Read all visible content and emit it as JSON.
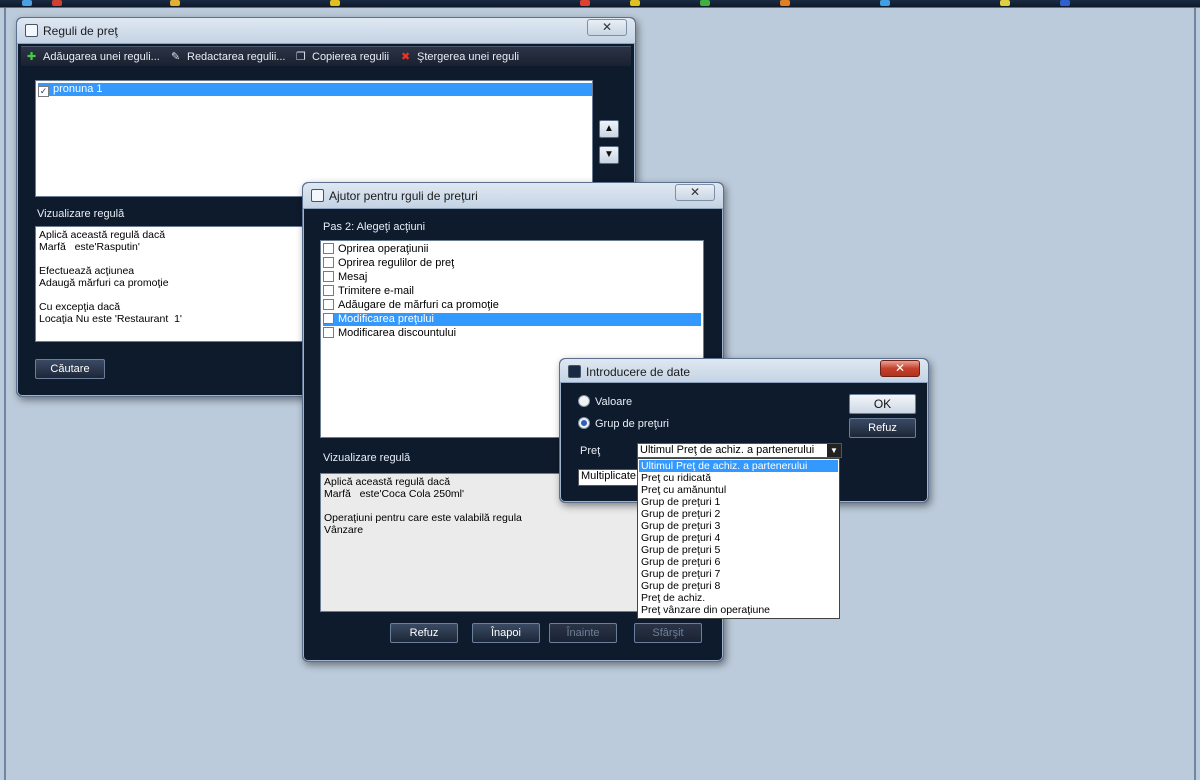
{
  "colors": {
    "desktop": "#bccbdb",
    "window_bg": "#0e1b2c",
    "selection": "#3399ff"
  },
  "rules_window": {
    "title": "Reguli de preţ",
    "close": "✕",
    "toolbar": [
      {
        "icon": "plus-icon",
        "glyph": "✚",
        "label": "Adăugarea unei reguli..."
      },
      {
        "icon": "edit-icon",
        "glyph": "✎",
        "label": "Redactarea regulii..."
      },
      {
        "icon": "copy-icon",
        "glyph": "❐",
        "label": "Copierea regulii"
      },
      {
        "icon": "delete-icon",
        "glyph": "✖",
        "label": "Ştergerea unei reguli"
      }
    ],
    "rules_list": [
      {
        "label": "pronuna 1",
        "checked": true
      }
    ],
    "up_arrow": "▲",
    "down_arrow": "▼",
    "preview_label": "Vizualizare regulă",
    "preview_text": "Aplică această regulă dacă\nMarfă   este'Rasputin'\n\nEfectuează acţiunea\nAdaugă mărfuri ca promoţie\n\nCu excepţia dacă\nLocaţia Nu este 'Restaurant  1'",
    "search_button": "Căutare"
  },
  "wizard_window": {
    "title": "Ajutor pentru rguli de preţuri",
    "close": "✕",
    "step_label": "Pas 2: Alegeţi acţiuni",
    "actions": [
      {
        "label": "Oprirea operaţiunii",
        "selected": false
      },
      {
        "label": "Oprirea regulilor de preţ",
        "selected": false
      },
      {
        "label": "Mesaj",
        "selected": false
      },
      {
        "label": "Trimitere e-mail",
        "selected": false
      },
      {
        "label": "Adăugare de mărfuri ca promoţie",
        "selected": false
      },
      {
        "label": "Modificarea preţului",
        "selected": true
      },
      {
        "label": "Modificarea discountului",
        "selected": false
      }
    ],
    "preview_label": "Vizualizare regulă",
    "preview_text": "Aplică această regulă dacă\nMarfă   este'Coca Cola 250ml'\n\nOperaţiuni pentru care este valabilă regula\nVânzare",
    "buttons": {
      "cancel": "Refuz",
      "back": "Înapoi",
      "next": "Înainte",
      "finish": "Sfârşit"
    }
  },
  "input_window": {
    "title": "Introducere de date",
    "close": "✕",
    "radio_value": "Valoare",
    "radio_price_group": "Grup de preţuri",
    "price_label": "Preţ",
    "price_selected": "Ultimul Preţ de achiz. a partenerului",
    "dropdown_arrow": "▼",
    "multiplicate_field": "Multiplicate",
    "ok_button": "OK",
    "cancel_button": "Refuz",
    "price_options": [
      "Ultimul Preţ de achiz. a partenerului",
      "Preţ cu ridicată",
      "Preţ cu amănuntul",
      "Grup de preţuri 1",
      "Grup de preţuri 2",
      "Grup de preţuri 3",
      "Grup de preţuri 4",
      "Grup de preţuri 5",
      "Grup de preţuri 6",
      "Grup de preţuri 7",
      "Grup de preţuri 8",
      "Preţ de achiz.",
      "Preţ vânzare din operaţiune"
    ]
  }
}
